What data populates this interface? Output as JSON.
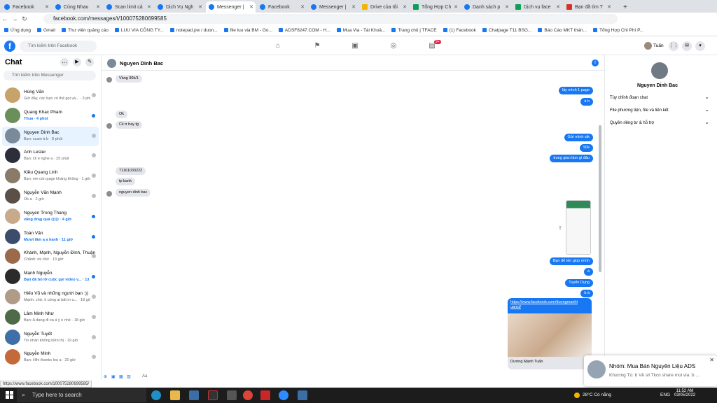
{
  "browser": {
    "tabs": [
      {
        "label": "Facebook",
        "icon": "fb",
        "active": false
      },
      {
        "label": "Cùng Nhau",
        "icon": "fb",
        "active": false
      },
      {
        "label": "Scan limit cả",
        "icon": "fb",
        "active": false
      },
      {
        "label": "Dịch Vụ Ngh",
        "icon": "fb",
        "active": false
      },
      {
        "label": "Messenger |",
        "icon": "fb",
        "active": true
      },
      {
        "label": "Facebook",
        "icon": "fb",
        "active": false
      },
      {
        "label": "Messenger |",
        "icon": "fb",
        "active": false
      },
      {
        "label": "Drive của tôi",
        "icon": "d",
        "active": false
      },
      {
        "label": "Tổng Hợp Ch",
        "icon": "g",
        "active": false
      },
      {
        "label": "Danh sách p",
        "icon": "fb",
        "active": false
      },
      {
        "label": "Dịch vụ face",
        "icon": "g",
        "active": false
      },
      {
        "label": "Bạn đã tìm T",
        "icon": "r",
        "active": false
      }
    ],
    "url": "facebook.com/messages/t/100075280699585",
    "bookmarks": [
      "Ứng dụng",
      "Gmail",
      "Thư viện quảng cáo",
      "LUU VIA CÔNG TY...",
      "notepad.pw / duon...",
      "file luu via BM - Go...",
      "ADSF8247.COM - H...",
      "Mua Via - Tài Khoả...",
      "Trang chủ | TFACE",
      "(1) Facebook",
      "Chatpage T11 BSG...",
      "Báo Cáo MKT thán...",
      "Tổng Hợp Chi Phí P..."
    ],
    "status_url": "https://www.facebook.com/100075280699585/"
  },
  "fb": {
    "search_placeholder": "Tìm kiếm trên Facebook",
    "notif_badge": "9+",
    "user_name": "Tuấn"
  },
  "chats": {
    "title": "Chat",
    "search_placeholder": "Tìm kiếm trên Messenger",
    "items": [
      {
        "name": "Hùng Văn",
        "preview": "Giờ đây, các bạn có thể gọi và... · 3 phút",
        "unread": false,
        "color": "#c7a36b"
      },
      {
        "name": "Quang Khac Pham",
        "preview": "Thua · 4 phút",
        "unread": true,
        "color": "#6b8f5a"
      },
      {
        "name": "Nguyen Dinh Bac",
        "preview": "Bạn: scam à b · 8 phút",
        "unread": false,
        "color": "#7b8a9b",
        "selected": true
      },
      {
        "name": "Anh Lester",
        "preview": "Bạn: Oi e nghe a · 25 phút",
        "unread": false,
        "color": "#2c2f3a"
      },
      {
        "name": "Kiều Quang Linh",
        "preview": "Bạn: em còn page kháng không · 1 giờ",
        "unread": false,
        "color": "#8a7a68"
      },
      {
        "name": "Nguyễn Văn Mạnh",
        "preview": "Ok a · 2 giờ",
        "unread": false,
        "color": "#5a5048"
      },
      {
        "name": "Nguyen Trong Thang",
        "preview": "vãng drag quá @@ · 4 giờ",
        "unread": true,
        "color": "#c9a98c"
      },
      {
        "name": "Toàn Văn",
        "preview": "Mượt lắm a a hanh · 11 giờ",
        "unread": true,
        "color": "#3c4c6c"
      },
      {
        "name": "Khánh, Mạnh, Nguyễn Đình, Thuận",
        "preview": "Chắnh: ok chứ · 13 giờ",
        "unread": false,
        "color": "#9a6a4a"
      },
      {
        "name": "Mạnh Nguyễn",
        "preview": "Bạn đã bỏ lỡ cuộc gọi video v... · 13 giờ",
        "unread": true,
        "color": "#2b2b2b"
      },
      {
        "name": "Hiếu Vũ và những người bạn :))",
        "preview": "Mạnh: chứ, k uống ai bắt m u... · 18 giờ",
        "unread": false,
        "color": "#b09a88"
      },
      {
        "name": "Lâm Minh Như",
        "preview": "Bạn: A đang đi xa á ý e nhé · 18 giờ",
        "unread": false,
        "color": "#4e6a48"
      },
      {
        "name": "Nguyễn Tuyết",
        "preview": "Tin nhắn không hiển thị · 19 giờ",
        "unread": false,
        "color": "#3f6fa8"
      },
      {
        "name": "Nguyễn Minh",
        "preview": "Bạn: Hihi thanks lou a · 20 giờ",
        "unread": false,
        "color": "#c46a3a"
      }
    ]
  },
  "conversation": {
    "name": "Nguyen Dinh Bac",
    "messages": [
      {
        "dir": "in",
        "text": "Vàng 90k/1"
      },
      {
        "dir": "out",
        "text": "lấy mình 1 page"
      },
      {
        "dir": "out",
        "text": "à b"
      },
      {
        "dir": "in",
        "text": "Ok"
      },
      {
        "dir": "in",
        "text": "Ck tr hay tg"
      },
      {
        "dir": "out",
        "text": "Gửi mình stk"
      },
      {
        "dir": "out",
        "text": "90k"
      },
      {
        "dir": "out",
        "text": "trung gian làm gì đâu"
      },
      {
        "dir": "in",
        "text": "71161033222"
      },
      {
        "dir": "in",
        "text": "tp bank"
      },
      {
        "dir": "in",
        "text": "nguyen dinh bac"
      },
      {
        "dir": "out",
        "text": "Bạn để tên giúp mình"
      },
      {
        "dir": "out",
        "text": "à"
      },
      {
        "dir": "out",
        "text": "Tuyển Dụng"
      },
      {
        "dir": "out",
        "text": "b à"
      }
    ],
    "link_preview": {
      "url": "https://www.facebook.com/duongmanht uanct/",
      "caption": "Dương Mạnh Tuấn"
    },
    "composer_label": "Aa"
  },
  "info_panel": {
    "name": "Nguyen Dinh Bac",
    "options": [
      "Tùy chỉnh đoạn chat",
      "File phương tiện, file và liên kết",
      "Quyền riêng tư & hỗ trợ"
    ]
  },
  "notification": {
    "title": "Nhóm: Mua Bán Nguyên Liệu ADS",
    "subtitle": "Khương Tú: b Về sll Tkcn share moi via :b ..."
  },
  "taskbar": {
    "search_placeholder": "Type here to search",
    "weather": "28°C Có nắng",
    "lang": "ENG",
    "time": "11:52 AM",
    "date": "03/05/2022"
  }
}
